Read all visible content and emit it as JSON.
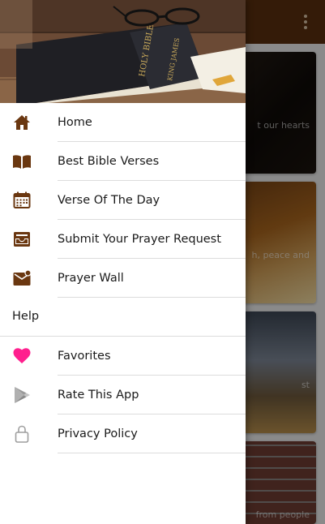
{
  "colors": {
    "appbar": "#5b2f0e",
    "icon_brown": "#6a3710",
    "favorite_pink": "#ff1f8e",
    "neutral_icon": "#9e9e9e"
  },
  "background_cards": [
    {
      "snippet": "t our hearts"
    },
    {
      "snippet": "h, peace and"
    },
    {
      "snippet": "st"
    },
    {
      "snippet": "from people"
    }
  ],
  "drawer": {
    "header_image": "bible-and-glasses-photo",
    "menu": [
      {
        "label": "Home",
        "icon": "home-icon"
      },
      {
        "label": "Best Bible Verses",
        "icon": "book-icon"
      },
      {
        "label": "Verse Of The Day",
        "icon": "calendar-icon"
      },
      {
        "label": "Submit Your Prayer Request",
        "icon": "inbox-icon"
      },
      {
        "label": "Prayer Wall",
        "icon": "mail-icon"
      }
    ],
    "section_title": "Help",
    "help_menu": [
      {
        "label": "Favorites",
        "icon": "heart-icon"
      },
      {
        "label": "Rate This App",
        "icon": "play-store-icon"
      },
      {
        "label": "Privacy Policy",
        "icon": "lock-icon"
      }
    ]
  }
}
